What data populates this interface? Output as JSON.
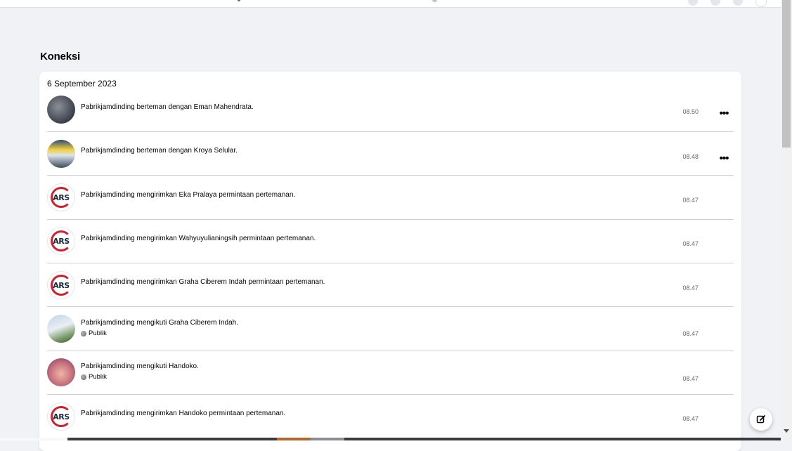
{
  "section": {
    "title": "Koneksi"
  },
  "activity": {
    "date": "6 September 2023",
    "entries": [
      {
        "text": "Pabrikjamdinding berteman dengan Eman Mahendrata.",
        "time": "08.50",
        "audience": "",
        "avatar": "photo",
        "has_menu": true
      },
      {
        "text": "Pabrikjamdinding berteman dengan Kroya Selular.",
        "time": "08.48",
        "audience": "",
        "avatar": "photo",
        "has_menu": true
      },
      {
        "text": "Pabrikjamdinding mengirimkan Eka Pralaya permintaan pertemanan.",
        "time": "08.47",
        "audience": "",
        "avatar": "ARS",
        "has_menu": false
      },
      {
        "text": "Pabrikjamdinding mengirimkan Wahyuyulianingsih permintaan pertemanan.",
        "time": "08.47",
        "audience": "",
        "avatar": "ARS",
        "has_menu": false
      },
      {
        "text": "Pabrikjamdinding mengirimkan Graha Ciberem Indah permintaan pertemanan.",
        "time": "08.47",
        "audience": "",
        "avatar": "ARS",
        "has_menu": false
      },
      {
        "text": "Pabrikjamdinding mengikuti Graha Ciberem Indah.",
        "time": "08.47",
        "audience": "Publik",
        "avatar": "photo",
        "has_menu": false
      },
      {
        "text": "Pabrikjamdinding mengikuti Handoko.",
        "time": "08.47",
        "audience": "Publik",
        "avatar": "photo",
        "has_menu": false
      },
      {
        "text": "Pabrikjamdinding mengirimkan Handoko permintaan pertemanan.",
        "time": "08.47",
        "audience": "",
        "avatar": "ARS",
        "has_menu": false
      }
    ]
  },
  "menu_icon": "more-horizontal-icon",
  "fab_icon": "edit-icon",
  "audience_icon": "globe-icon",
  "colors": {
    "background": "#f0f2f5",
    "card": "#ffffff",
    "divider": "#ced0d4",
    "secondary_text": "#65676b",
    "ars_red": "#d01f2b"
  }
}
